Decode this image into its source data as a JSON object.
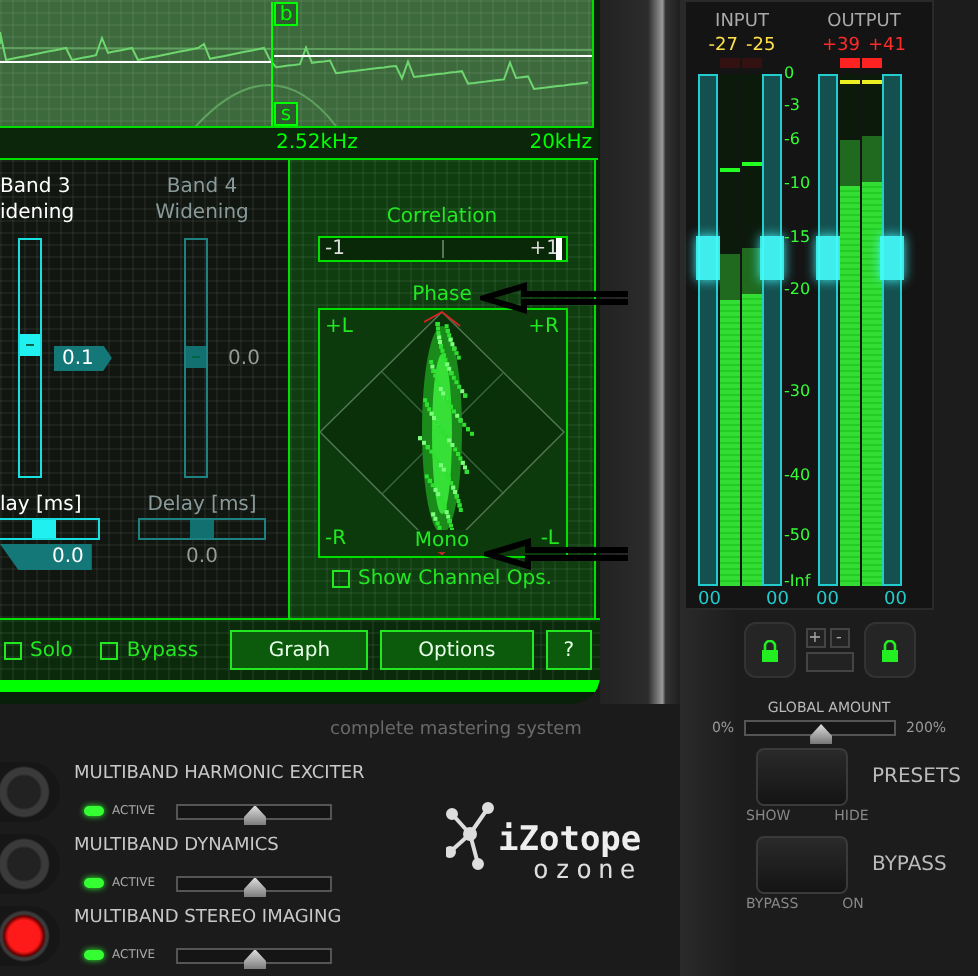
{
  "graph": {
    "markers": [
      "b",
      "s"
    ],
    "frequencies": [
      "2.52kHz",
      "20kHz"
    ]
  },
  "bands": [
    {
      "title": [
        "Band 3",
        "idening"
      ],
      "selected": true,
      "value": "0.1",
      "level": 0.55,
      "delay": {
        "label": "lay [ms]",
        "value": "0.0",
        "level": 0.45
      }
    },
    {
      "title": [
        "Band 4",
        "Widening"
      ],
      "selected": false,
      "value": "0.0",
      "level": 0.5,
      "delay": {
        "label": "Delay [ms]",
        "value": "0.0",
        "level": 0.5
      }
    }
  ],
  "correlation": {
    "label": "Correlation",
    "min": "-1",
    "max": "+1",
    "level": 0.97
  },
  "phase": {
    "label": "Phase",
    "corners": [
      "+L",
      "+R",
      "-R",
      "-L"
    ],
    "center": "Mono"
  },
  "show_channel_ops": {
    "label": "Show Channel Ops.",
    "checked": false
  },
  "toggles": [
    {
      "label": "Solo",
      "checked": false
    },
    {
      "label": "Bypass",
      "checked": false
    }
  ],
  "buttons": [
    "Graph",
    "Options",
    "?"
  ],
  "tagline": "complete mastering system",
  "meters": {
    "groups": [
      {
        "label": "INPUT",
        "channels": [
          {
            "peak": "-27",
            "level": 0.56,
            "clip": false
          },
          {
            "peak": "-25",
            "level": 0.57,
            "clip": false
          }
        ]
      },
      {
        "label": "OUTPUT",
        "channels": [
          {
            "peak": "+39",
            "level": 0.78,
            "clip": true
          },
          {
            "peak": "+41",
            "level": 0.79,
            "clip": true
          }
        ]
      }
    ],
    "scale": [
      "0",
      "-3",
      "-6",
      "-10",
      "-15",
      "-20",
      "-30",
      "-40",
      "-50",
      "-Inf"
    ],
    "trims": [
      {
        "readout": "00",
        "level": 0.64
      },
      {
        "readout": "00",
        "level": 0.64
      },
      {
        "readout": "00",
        "level": 0.64
      },
      {
        "readout": "00",
        "level": 0.64
      }
    ],
    "buttons": [
      "+",
      "-"
    ]
  },
  "global_amount": {
    "label": "GLOBAL AMOUNT",
    "min": "0%",
    "max": "200%",
    "level": 0.5
  },
  "modules": [
    {
      "name": "MULTIBAND HARMONIC EXCITER",
      "status": "ACTIVE",
      "active": true,
      "selected": false,
      "level": 0.5
    },
    {
      "name": "MULTIBAND DYNAMICS",
      "status": "ACTIVE",
      "active": true,
      "selected": false,
      "level": 0.5
    },
    {
      "name": "MULTIBAND STEREO IMAGING",
      "status": "ACTIVE",
      "active": true,
      "selected": true,
      "level": 0.5
    }
  ],
  "logo": {
    "brand": "iZotope",
    "product": "ozone"
  },
  "presets": {
    "label": "PRESETS",
    "options": [
      "SHOW",
      "HIDE"
    ]
  },
  "bypass": {
    "label": "BYPASS",
    "options": [
      "BYPASS",
      "ON"
    ]
  }
}
